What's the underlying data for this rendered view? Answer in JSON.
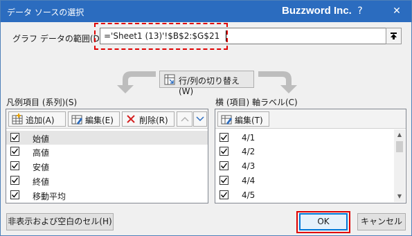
{
  "window": {
    "title": "データ ソースの選択",
    "brand": "Buzzword Inc.",
    "help_glyph": "?",
    "close_glyph": "✕"
  },
  "range": {
    "label": "グラフ データの範囲(D):",
    "value": "='Sheet1 (13)'!$B$2:$G$21"
  },
  "switch_button": {
    "label": "行/列の切り替え(W)"
  },
  "series_panel": {
    "label": "凡例項目 (系列)(S)",
    "add": "追加(A)",
    "edit": "編集(E)",
    "delete": "削除(R)",
    "items": [
      {
        "label": "始値",
        "checked": true,
        "selected": true
      },
      {
        "label": "高値",
        "checked": true,
        "selected": false
      },
      {
        "label": "安値",
        "checked": true,
        "selected": false
      },
      {
        "label": "終値",
        "checked": true,
        "selected": false
      },
      {
        "label": "移動平均",
        "checked": true,
        "selected": false
      }
    ]
  },
  "category_panel": {
    "label": "横 (項目) 軸ラベル(C)",
    "edit": "編集(T)",
    "items": [
      {
        "label": "4/1",
        "checked": true
      },
      {
        "label": "4/2",
        "checked": true
      },
      {
        "label": "4/3",
        "checked": true
      },
      {
        "label": "4/4",
        "checked": true
      },
      {
        "label": "4/5",
        "checked": true
      }
    ]
  },
  "footer": {
    "hidden_cells": "非表示および空白のセル(H)",
    "ok": "OK",
    "cancel": "キャンセル"
  },
  "colors": {
    "titlebar": "#2b6cbf",
    "highlight": "#e00000",
    "ok_border": "#0078d7"
  }
}
